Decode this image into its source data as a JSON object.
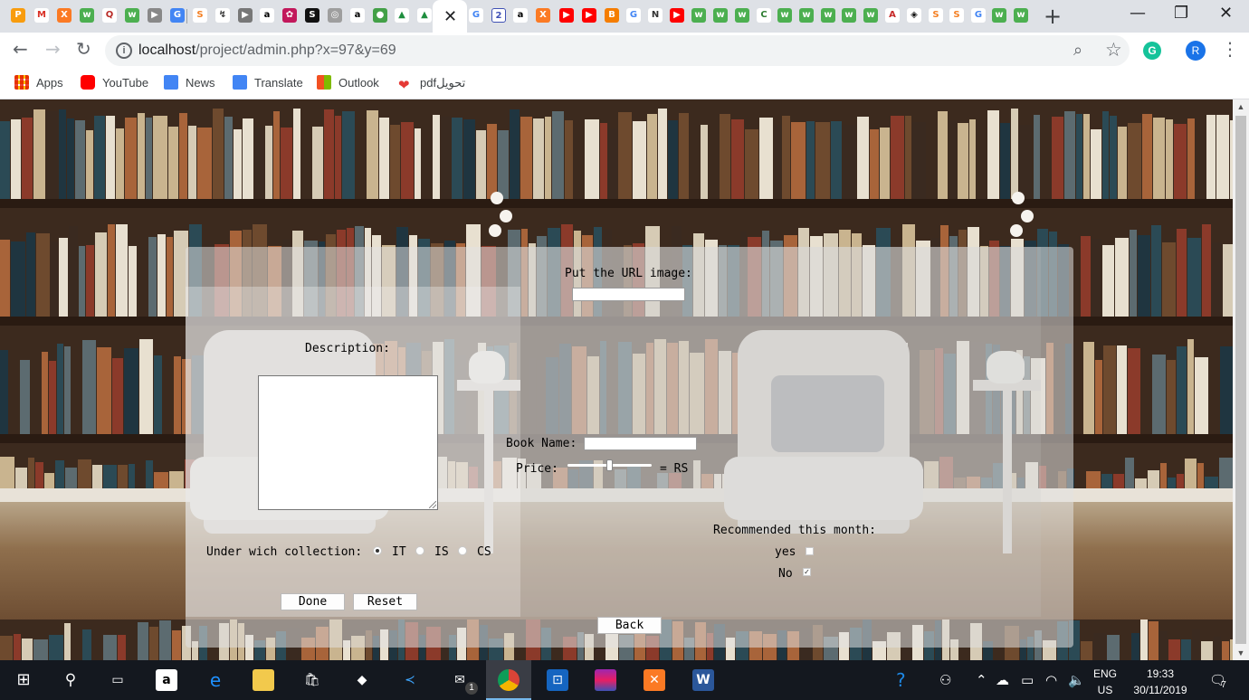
{
  "browser": {
    "tab_count_hint": "many",
    "address": {
      "host": "localhost",
      "path": "/project/admin.php?x=97&y=69"
    },
    "profile_initial": "R",
    "grammarly_letter": "G"
  },
  "bookmarks": [
    {
      "label": "Apps",
      "icon": "apps-grid-icon"
    },
    {
      "label": "YouTube",
      "icon": "youtube-icon"
    },
    {
      "label": "News",
      "icon": "news-icon"
    },
    {
      "label": "Translate",
      "icon": "translate-icon"
    },
    {
      "label": "Outlook",
      "icon": "outlook-icon"
    },
    {
      "label": "pdfتحويل",
      "icon": "heart-icon"
    }
  ],
  "form": {
    "url_image_label": "Put the URL image:",
    "url_image_value": "",
    "description_label": "Description:",
    "description_value": "",
    "book_name_label": "Book Name:",
    "book_name_value": "",
    "price_label": "Price:",
    "price_suffix": "= RS",
    "price_slider_level": 0.5,
    "collection_label": "Under wich collection:",
    "collections": [
      {
        "label": "IT",
        "checked": true
      },
      {
        "label": "IS",
        "checked": false
      },
      {
        "label": "CS",
        "checked": false
      }
    ],
    "recommended_label": "Recommended this month:",
    "recommended_options": [
      {
        "label": "yes",
        "checked": false
      },
      {
        "label": "No",
        "checked": true
      }
    ],
    "done_label": "Done",
    "reset_label": "Reset",
    "back_label": "Back"
  },
  "taskbar": {
    "lang_top": "ENG",
    "lang_bottom": "US",
    "time": "19:33",
    "date": "30/11/2019",
    "notification_count": "7",
    "mail_badge": "1"
  }
}
